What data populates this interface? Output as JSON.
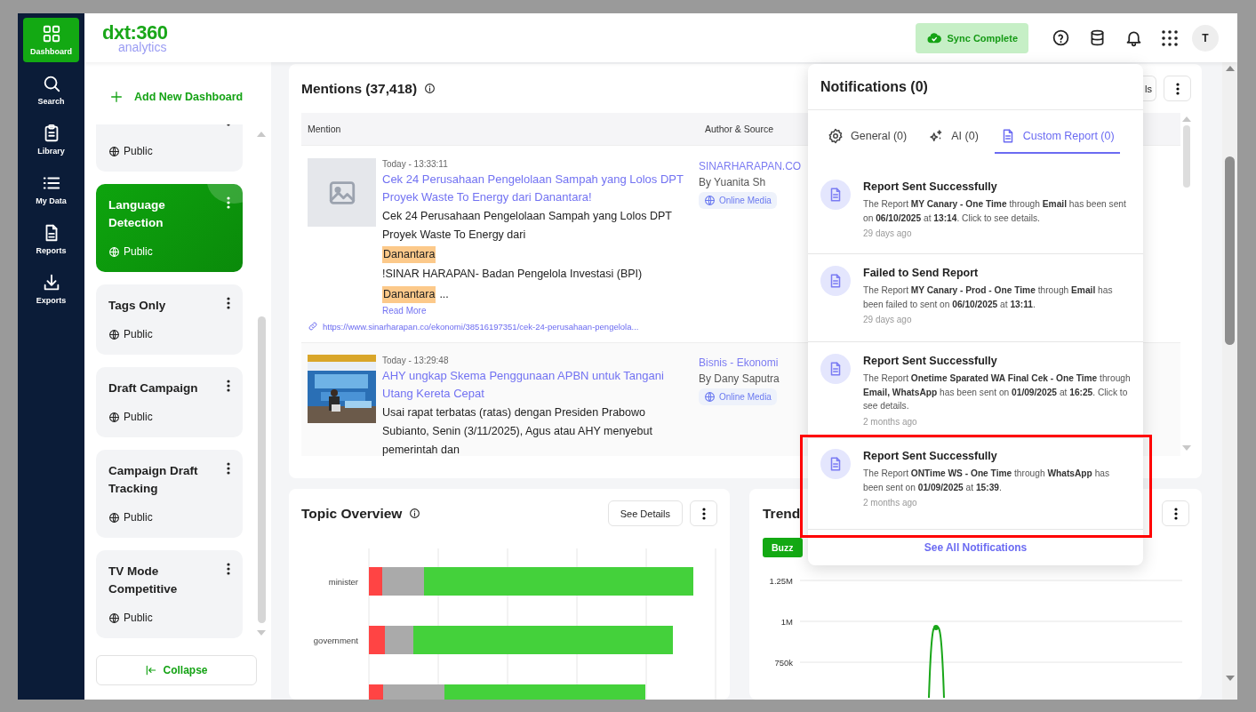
{
  "nav": {
    "items": [
      {
        "label": "Dashboard",
        "selected": true
      },
      {
        "label": "Search",
        "selected": false
      },
      {
        "label": "Library",
        "selected": false
      },
      {
        "label": "My Data",
        "selected": false
      },
      {
        "label": "Reports",
        "selected": false
      },
      {
        "label": "Exports",
        "selected": false
      }
    ]
  },
  "header": {
    "logo": {
      "brand": "dxt:360",
      "tagline": "analytics"
    },
    "sync_status": "Sync Complete",
    "avatar": "T"
  },
  "sidebar": {
    "add_button": "Add New Dashboard",
    "dashboards": [
      {
        "visibility": "Public",
        "selected": false
      },
      {
        "title": "Language Detection",
        "visibility": "Public",
        "selected": true
      },
      {
        "title": "Tags Only",
        "visibility": "Public",
        "selected": false
      },
      {
        "title": "Draft Campaign",
        "visibility": "Public",
        "selected": false
      },
      {
        "title": "Campaign Draft Tracking",
        "visibility": "Public",
        "selected": false
      },
      {
        "title": "TV Mode Competitive",
        "visibility": "Public",
        "selected": false
      }
    ],
    "collapse_button": "Collapse"
  },
  "mentions": {
    "title": "Mentions (37,418)",
    "button": "ls",
    "columns": [
      "Mention",
      "Author & Source"
    ],
    "rows": [
      {
        "kind": "placeholder",
        "time": "Today - 13:33:11",
        "title": "Cek 24 Perusahaan Pengelolaan Sampah yang Lolos DPT Proyek Waste To Energy dari Danantara!",
        "snippet": [
          [
            {
              "text": "Cek 24 Perusahaan Pengelolaan Sampah yang Lolos DPT Proyek Waste To Energy dari",
              "highlight": false
            }
          ],
          [
            {
              "text": "Danantara",
              "highlight": true
            }
          ],
          [
            {
              "text": "!SINAR HARAPAN- Badan Pengelola Investasi (BPI)",
              "highlight": false
            }
          ],
          [
            {
              "text": "Danantara",
              "highlight": true
            },
            {
              "text": "...",
              "highlight": false
            }
          ]
        ],
        "read_more": "Read More",
        "url": "https://www.sinarharapan.co/ekonomi/38516197351/cek-24-perusahaan-pengelola...",
        "source": "SINARHARAPAN.CO",
        "author": "By Yuanita Sh",
        "media_type": "Online Media"
      },
      {
        "kind": "picture",
        "time": "Today - 13:29:48",
        "title": "AHY ungkap Skema Penggunaan APBN untuk Tangani Utang Kereta Cepat",
        "snippet": [
          [
            {
              "text": "Usai rapat terbatas (ratas) dengan Presiden Prabowo Subianto, Senin (3/11/2025), Agus atau AHY menyebut pemerintah dan",
              "highlight": false
            }
          ]
        ],
        "source": "Bisnis - Ekonomi",
        "author": "By Dany Saputra",
        "media_type": "Online Media"
      }
    ]
  },
  "topic_overview": {
    "title": "Topic Overview",
    "button": "See Details",
    "categories": [
      "minister",
      "government"
    ]
  },
  "trend": {
    "title": "Trend",
    "filter": "Buzz",
    "yticks": [
      "1.25M",
      "1M",
      "750k"
    ]
  },
  "notifications": {
    "title": "Notifications (0)",
    "tabs": [
      {
        "label": "General (0)",
        "selected": false
      },
      {
        "label": "AI (0)",
        "selected": false
      },
      {
        "label": "Custom Report (0)",
        "selected": true
      }
    ],
    "items": [
      {
        "title": "Report Sent Successfully",
        "body": "The Report **MY Canary - One Time** through **Email** has been sent on **06/10/2025** at **13:14**. Click to see details.",
        "age": "29 days ago",
        "highlighted": false
      },
      {
        "title": "Failed to Send Report",
        "body": "The Report **MY Canary - Prod - One Time** through **Email** has been failed to sent on **06/10/2025** at **13:11**.",
        "age": "29 days ago",
        "highlighted": false
      },
      {
        "title": "Report Sent Successfully",
        "body": "The Report **Onetime Sparated WA Final Cek - One Time** through **Email, WhatsApp** has been sent on **01/09/2025** at **16:25**. Click to see details.",
        "age": "2 months ago",
        "highlighted": false
      },
      {
        "title": "Report Sent Successfully",
        "body": "The Report **ONTime WS - One Time** through **WhatsApp** has been sent on **01/09/2025** at **15:39**.",
        "age": "2 months ago",
        "highlighted": true
      }
    ],
    "footer": "See All Notifications"
  }
}
